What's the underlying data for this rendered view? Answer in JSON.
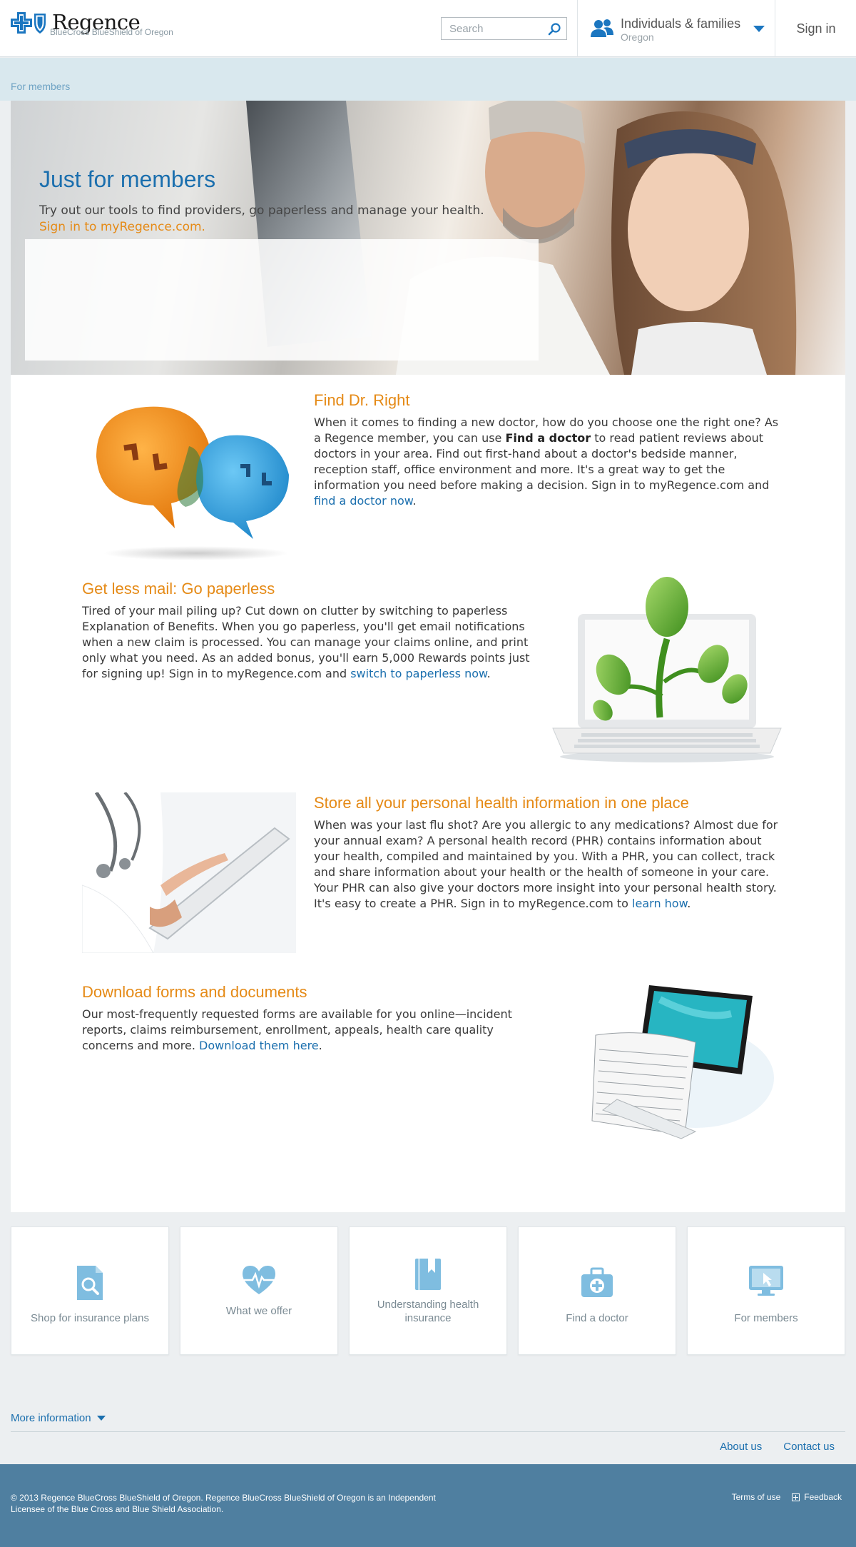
{
  "header": {
    "logo_name": "Regence",
    "logo_sub": "BlueCross BlueShield of Oregon",
    "search_placeholder": "Search",
    "audience_title": "Individuals & families",
    "audience_sub": "Oregon",
    "signin_label": "Sign in"
  },
  "breadcrumb": "For members",
  "hero": {
    "title": "Just for members",
    "text": "Try out our tools to find providers, go paperless and manage your health.",
    "link": "Sign in to myRegence.com."
  },
  "sections": [
    {
      "title": "Find Dr. Right",
      "pre": "When it comes to finding a new doctor, how do you choose one the right one? As a Regence member, you can use ",
      "bold": "Find a doctor",
      "post": " to read patient reviews about doctors in your area. Find out first-hand about a doctor's bedside manner, reception staff, office environment and more. It's a great way to get the information you need before making a decision. Sign in to myRegence.com and ",
      "link": "find a doctor now",
      "end": "."
    },
    {
      "title": "Get less mail: Go paperless",
      "pre": "Tired of your mail piling up? Cut down on clutter by switching to paperless Explanation of Benefits. When you go paperless, you'll get email notifications when a new claim is processed. You can manage your claims online, and print only what you need. As an added bonus, you'll earn 5,000 Rewards points just for signing up! Sign in to myRegence.com and ",
      "link": "switch to paperless now",
      "end": "."
    },
    {
      "title": "Store all your personal health information in one place",
      "pre": "When was your last flu shot? Are you allergic to any medications? Almost due for your annual exam?  A personal health record (PHR) contains information about your health, compiled and maintained by you. With a PHR, you can collect, track and share information about your health or the health of someone in your care. Your PHR can also give your doctors more insight into your personal health story. It's easy to create a PHR. Sign in to myRegence.com to ",
      "link": "learn how",
      "end": "."
    },
    {
      "title": "Download forms and documents",
      "pre": "Our most-frequently requested forms are available for you online—incident reports, claims reimbursement, enrollment, appeals, health care quality concerns and more. ",
      "link": "Download them here",
      "end": "."
    }
  ],
  "tiles": [
    {
      "label": "Shop for insurance plans",
      "icon": "document-search-icon"
    },
    {
      "label": "What we offer",
      "icon": "heart-pulse-icon"
    },
    {
      "label": "Understanding health insurance",
      "icon": "book-icon"
    },
    {
      "label": "Find a doctor",
      "icon": "medical-bag-icon"
    },
    {
      "label": "For members",
      "icon": "computer-cursor-icon"
    }
  ],
  "more_info": "More information",
  "utility_links": {
    "about": "About us",
    "contact": "Contact us"
  },
  "footer": {
    "copyright": "© 2013 Regence BlueCross BlueShield of Oregon. Regence BlueCross BlueShield of Oregon is an Independent Licensee of the Blue Cross and Blue Shield Association.",
    "terms": "Terms of use",
    "feedback": "Feedback"
  },
  "colors": {
    "brand_blue": "#1b6fae",
    "accent_orange": "#e58a16",
    "footer_blue": "#4f7fa0",
    "icon_light_blue": "#7fbde0"
  }
}
